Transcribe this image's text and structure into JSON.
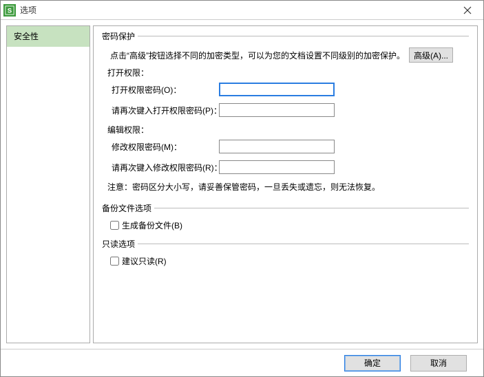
{
  "window": {
    "title": "选项"
  },
  "sidebar": {
    "items": [
      {
        "label": "安全性"
      }
    ]
  },
  "sections": {
    "password": {
      "legend": "密码保护",
      "help": "点击“高级”按钮选择不同的加密类型，可以为您的文档设置不同级别的加密保护。",
      "adv_button": "高级(A)...",
      "open_header": "打开权限：",
      "open_label": "打开权限密码(O)：",
      "open_confirm_label": "请再次键入打开权限密码(P)：",
      "edit_header": "编辑权限：",
      "edit_label": "修改权限密码(M)：",
      "edit_confirm_label": "请再次键入修改权限密码(R)：",
      "note": "注意：密码区分大小写，请妥善保管密码，一旦丢失或遗忘，则无法恢复。"
    },
    "backup": {
      "legend": "备份文件选项",
      "gen_backup_label": "生成备份文件(B)"
    },
    "readonly": {
      "legend": "只读选项",
      "recommend_label": "建议只读(R)"
    }
  },
  "footer": {
    "ok": "确定",
    "cancel": "取消"
  }
}
